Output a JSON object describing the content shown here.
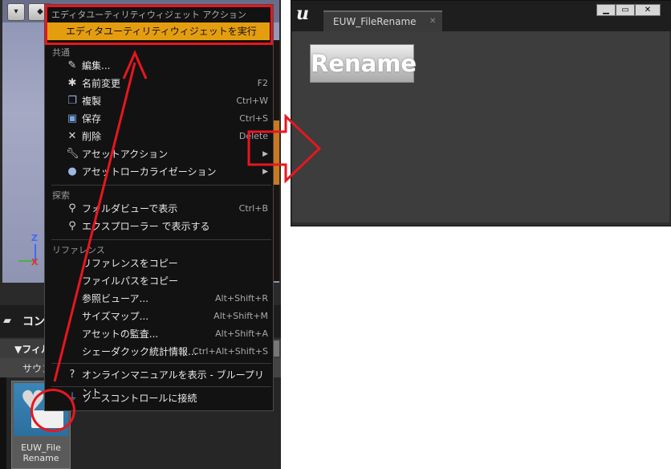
{
  "editor": {
    "content_browser_label": "コン",
    "filter_label": "フィル",
    "sound_label": "サウン",
    "asset_name": "EUW_File\nRename"
  },
  "menu": {
    "header": "エディタユーティリティウィジェット アクション",
    "run_label": "エディタユーティリティウィジェットを実行",
    "sections": {
      "common": "共通",
      "explore": "探索",
      "reference": "リファレンス"
    },
    "common_items": [
      {
        "label": "編集...",
        "shortcut": "",
        "icon": "pencil-icon"
      },
      {
        "label": "名前変更",
        "shortcut": "F2",
        "icon": "rename-icon"
      },
      {
        "label": "複製",
        "shortcut": "Ctrl+W",
        "icon": "duplicate-icon"
      },
      {
        "label": "保存",
        "shortcut": "Ctrl+S",
        "icon": "save-icon"
      },
      {
        "label": "削除",
        "shortcut": "Delete",
        "icon": "delete-icon"
      },
      {
        "label": "アセットアクション",
        "shortcut": "",
        "icon": "wrench-icon"
      },
      {
        "label": "アセットローカライゼーション",
        "shortcut": "",
        "icon": "globe-icon"
      }
    ],
    "explore_items": [
      {
        "label": "フォルダビューで表示",
        "shortcut": "Ctrl+B"
      },
      {
        "label": "エクスプローラー で表示する",
        "shortcut": ""
      }
    ],
    "reference_items": [
      {
        "label": "リファレンスをコピー",
        "shortcut": ""
      },
      {
        "label": "ファイルパスをコピー",
        "shortcut": ""
      },
      {
        "label": "参照ビューア...",
        "shortcut": "Alt+Shift+R"
      },
      {
        "label": "サイズマップ...",
        "shortcut": "Alt+Shift+M"
      },
      {
        "label": "アセットの監査...",
        "shortcut": "Alt+Shift+A"
      },
      {
        "label": "シェーダクック統計情報...",
        "shortcut": "Ctrl+Alt+Shift+S"
      }
    ],
    "manual_label": "オンラインマニュアルを表示 - ブループリント",
    "source_control_label": "ソースコントロールに接続"
  },
  "window": {
    "tab_label": "EUW_FileRename",
    "rename_button": "Rename"
  },
  "colors": {
    "highlight": "#e59d10",
    "annotation": "#e8161f"
  }
}
